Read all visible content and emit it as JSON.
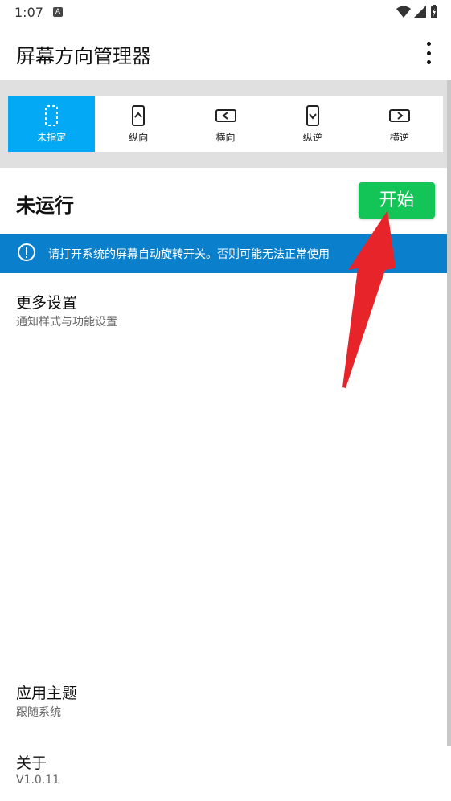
{
  "status_bar": {
    "time": "1:07",
    "notification_badge": "A",
    "icons": [
      "wifi-icon",
      "signal-icon",
      "battery-charging-icon"
    ]
  },
  "app_bar": {
    "title": "屏幕方向管理器",
    "overflow_icon": "more-vert-icon"
  },
  "orientation_tabs": [
    {
      "label": "未指定",
      "icon": "unspecified-icon",
      "active": true
    },
    {
      "label": "纵向",
      "icon": "portrait-icon",
      "active": false
    },
    {
      "label": "横向",
      "icon": "landscape-icon",
      "active": false
    },
    {
      "label": "纵逆",
      "icon": "reverse-portrait-icon",
      "active": false
    },
    {
      "label": "横逆",
      "icon": "reverse-landscape-icon",
      "active": false
    }
  ],
  "run": {
    "status": "未运行",
    "start_label": "开始"
  },
  "notice": {
    "text": "请打开系统的屏幕自动旋转开关。否则可能无法正常使用"
  },
  "settings": [
    {
      "title": "更多设置",
      "subtitle": "通知样式与功能设置"
    },
    {
      "title": "应用主题",
      "subtitle": "跟随系统"
    },
    {
      "title": "关于",
      "subtitle": "V1.0.11"
    }
  ],
  "colors": {
    "active_tab": "#03a9f4",
    "start_button": "#13c457",
    "notice_bg": "#0a7fcb",
    "arrow": "#e8242b"
  }
}
